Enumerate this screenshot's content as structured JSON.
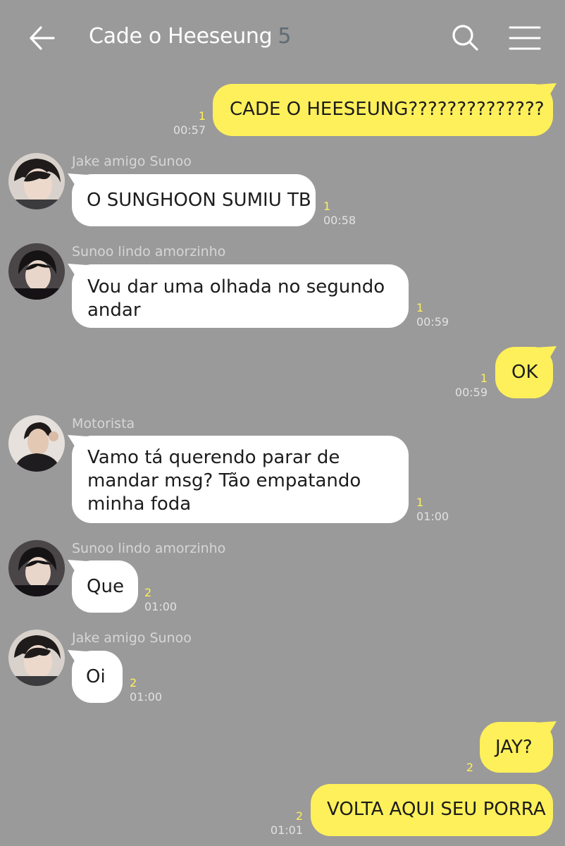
{
  "header": {
    "title": "Cade o Heeseung",
    "member_count": "5"
  },
  "messages": [
    {
      "sender": "",
      "text": "CADE O HEESEUNG??????????????",
      "unread": "1",
      "time": "00:57"
    },
    {
      "sender": "Jake amigo Sunoo",
      "text": "O SUNGHOON SUMIU TB",
      "unread": "1",
      "time": "00:58"
    },
    {
      "sender": "Sunoo lindo amorzinho",
      "text": "Vou dar uma olhada no segundo andar",
      "unread": "1",
      "time": "00:59"
    },
    {
      "sender": "",
      "text": "OK",
      "unread": "1",
      "time": "00:59"
    },
    {
      "sender": "Motorista",
      "text": "Vamo tá querendo parar de mandar msg? Tão empatando minha foda",
      "unread": "1",
      "time": "01:00"
    },
    {
      "sender": "Sunoo lindo amorzinho",
      "text": "Que",
      "unread": "2",
      "time": "01:00"
    },
    {
      "sender": "Jake amigo Sunoo",
      "text": "Oi",
      "unread": "2",
      "time": "01:00"
    },
    {
      "sender": "",
      "text": "JAY?",
      "unread": "2",
      "time": ""
    },
    {
      "sender": "",
      "text": "VOLTA AQUI SEU PORRA",
      "unread": "2",
      "time": "01:01"
    }
  ],
  "colors": {
    "background": "#9a9a9a",
    "outgoing_bubble": "#fef05a",
    "incoming_bubble": "#ffffff",
    "unread_count": "#fef05a"
  },
  "icons": [
    "back-arrow-icon",
    "search-icon",
    "menu-icon"
  ]
}
